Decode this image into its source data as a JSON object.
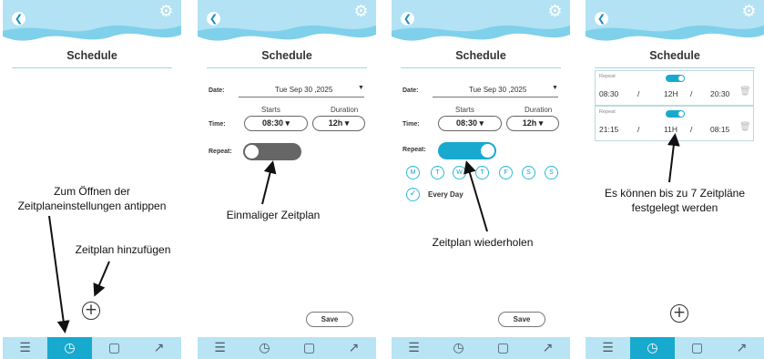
{
  "colors": {
    "accent": "#18a9cf",
    "nav_bg": "#b8e4f3",
    "toggle_off": "#666666"
  },
  "icons": {
    "back": "chevron-left-icon",
    "settings": "gear-icon",
    "add": "plus-circle-icon",
    "delete": "trash-icon"
  },
  "nav": {
    "items": [
      {
        "name": "menu",
        "glyph": "☰"
      },
      {
        "name": "schedule",
        "glyph": "◷"
      },
      {
        "name": "device",
        "glyph": "▢"
      },
      {
        "name": "chart",
        "glyph": "↗"
      }
    ]
  },
  "screens": {
    "list_empty": {
      "title": "Schedule",
      "add_symbol": "+"
    },
    "edit_once": {
      "title": "Schedule",
      "date_label": "Date:",
      "date_value": "Tue Sep 30 ,2025",
      "starts_label": "Starts",
      "duration_label": "Duration",
      "time_label": "Time:",
      "start_value": "08:30",
      "duration_value": "12h",
      "repeat_label": "Repeat:",
      "repeat_on": false,
      "save_label": "Save"
    },
    "edit_repeat": {
      "title": "Schedule",
      "date_label": "Date:",
      "date_value": "Tue Sep 30 ,2025",
      "starts_label": "Starts",
      "duration_label": "Duration",
      "time_label": "Time:",
      "start_value": "08:30",
      "duration_value": "12h",
      "repeat_label": "Repeat:",
      "repeat_on": true,
      "days": [
        "M",
        "T",
        "W",
        "T",
        "F",
        "S",
        "S"
      ],
      "every_day_label": "Every Day",
      "save_label": "Save"
    },
    "list_filled": {
      "title": "Schedule",
      "add_symbol": "+",
      "rows": [
        {
          "repeat_label": "Repeat",
          "start": "08:30",
          "sep1": "/",
          "duration": "12H",
          "sep2": "/",
          "end": "20:30"
        },
        {
          "repeat_label": "Repeat",
          "start": "21:15",
          "sep1": "/",
          "duration": "11H",
          "sep2": "/",
          "end": "08:15"
        }
      ]
    }
  },
  "captions": {
    "open_settings": "Zum Öffnen der Zeitplaneinstellungen antippen",
    "add_schedule": "Zeitplan hinzufügen",
    "single_schedule": "Einmaliger Zeitplan",
    "repeat_schedule": "Zeitplan wiederholen",
    "max_schedules": "Es können bis zu 7 Zeitpläne festgelegt werden"
  }
}
